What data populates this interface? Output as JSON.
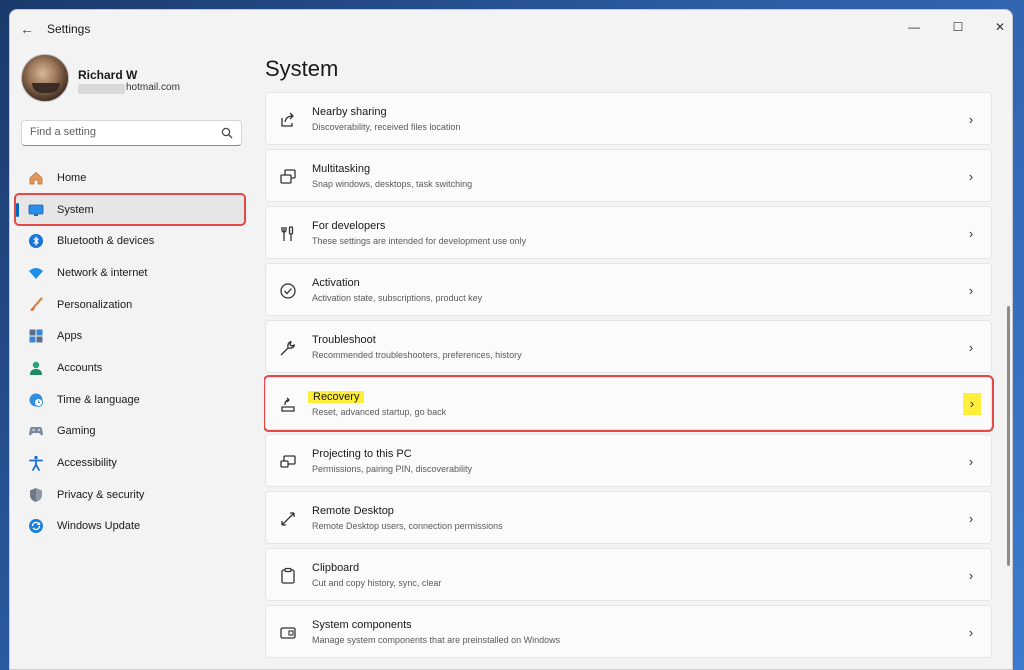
{
  "window": {
    "title": "Settings",
    "controls": {
      "minimize": "—",
      "maximize": "☐",
      "close": "✕"
    }
  },
  "profile": {
    "name": "Richard W",
    "email_suffix": "hotmail.com"
  },
  "search": {
    "placeholder": "Find a setting"
  },
  "nav": {
    "items": [
      {
        "label": "Home",
        "icon": "home-icon"
      },
      {
        "label": "System",
        "icon": "system-icon",
        "selected": true
      },
      {
        "label": "Bluetooth & devices",
        "icon": "bluetooth-icon"
      },
      {
        "label": "Network & internet",
        "icon": "wifi-icon"
      },
      {
        "label": "Personalization",
        "icon": "brush-icon"
      },
      {
        "label": "Apps",
        "icon": "apps-icon"
      },
      {
        "label": "Accounts",
        "icon": "accounts-icon"
      },
      {
        "label": "Time & language",
        "icon": "globe-clock-icon"
      },
      {
        "label": "Gaming",
        "icon": "gamepad-icon"
      },
      {
        "label": "Accessibility",
        "icon": "accessibility-icon"
      },
      {
        "label": "Privacy & security",
        "icon": "shield-icon"
      },
      {
        "label": "Windows Update",
        "icon": "windows-update-icon"
      }
    ]
  },
  "page": {
    "title": "System"
  },
  "cards": [
    {
      "title": "Nearby sharing",
      "subtitle": "Discoverability, received files location",
      "icon": "share-icon"
    },
    {
      "title": "Multitasking",
      "subtitle": "Snap windows, desktops, task switching",
      "icon": "multitasking-icon"
    },
    {
      "title": "For developers",
      "subtitle": "These settings are intended for development use only",
      "icon": "developer-tools-icon"
    },
    {
      "title": "Activation",
      "subtitle": "Activation state, subscriptions, product key",
      "icon": "activation-check-icon"
    },
    {
      "title": "Troubleshoot",
      "subtitle": "Recommended troubleshooters, preferences, history",
      "icon": "wrench-icon"
    },
    {
      "title": "Recovery",
      "subtitle": "Reset, advanced startup, go back",
      "icon": "recovery-icon",
      "highlighted": true
    },
    {
      "title": "Projecting to this PC",
      "subtitle": "Permissions, pairing PIN, discoverability",
      "icon": "projecting-icon"
    },
    {
      "title": "Remote Desktop",
      "subtitle": "Remote Desktop users, connection permissions",
      "icon": "remote-desktop-icon"
    },
    {
      "title": "Clipboard",
      "subtitle": "Cut and copy history, sync, clear",
      "icon": "clipboard-icon"
    },
    {
      "title": "System components",
      "subtitle": "Manage system components that are preinstalled on Windows",
      "icon": "system-components-icon"
    }
  ],
  "chevron": "›",
  "colors": {
    "accent": "#0067c0",
    "annotation_red": "#e24a4a",
    "highlight_yellow": "#ffef3b"
  }
}
